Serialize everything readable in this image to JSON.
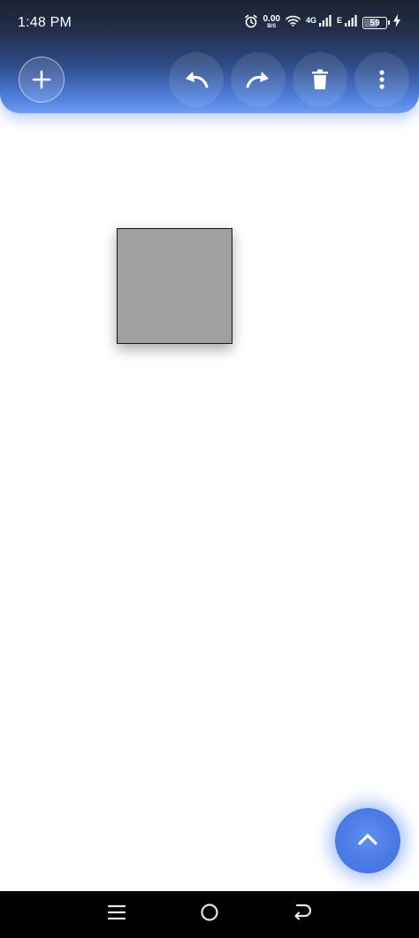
{
  "status_bar": {
    "time": "1:48 PM",
    "net_speed_value": "0.00",
    "net_speed_unit": "B/S",
    "network_label_1": "4G",
    "network_label_2": "E",
    "battery_level": "59",
    "battery_fraction": 0.59,
    "icons": [
      "alarm-icon",
      "wifi-icon",
      "signal-icon",
      "signal-icon",
      "battery-icon",
      "charging-icon"
    ]
  },
  "toolbar": {
    "buttons": [
      {
        "name": "add-button",
        "icon": "plus-icon"
      },
      {
        "name": "undo-button",
        "icon": "undo-icon"
      },
      {
        "name": "redo-button",
        "icon": "redo-icon"
      },
      {
        "name": "delete-button",
        "icon": "trash-icon"
      },
      {
        "name": "more-button",
        "icon": "more-vertical-icon"
      }
    ]
  },
  "canvas": {
    "shapes": [
      {
        "type": "square",
        "fill": "#a0a0a0",
        "stroke": "#1a1a1a"
      }
    ]
  },
  "fab": {
    "icon": "chevron-up-icon"
  },
  "nav_bar": {
    "buttons": [
      {
        "name": "nav-recents-button",
        "icon": "menu-icon"
      },
      {
        "name": "nav-home-button",
        "icon": "home-circle-icon"
      },
      {
        "name": "nav-back-button",
        "icon": "back-icon"
      }
    ]
  },
  "colors": {
    "header_top": "#1b2333",
    "header_bottom": "#6f9cf2",
    "fab": "#4a7be6",
    "shape_fill": "#a0a0a0",
    "nav_bar": "#000000"
  }
}
